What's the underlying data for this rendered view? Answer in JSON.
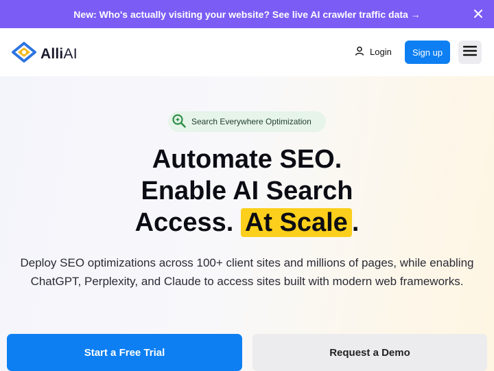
{
  "announcement": {
    "text": "New: Who's actually visiting your website? See live AI crawler traffic data →",
    "close_icon": "close-icon"
  },
  "nav": {
    "brand_bold": "Alli",
    "brand_light": "AI",
    "login_label": "Login",
    "signup_label": "Sign up",
    "menu_icon": "hamburger-menu-icon"
  },
  "hero": {
    "pill_text": "Search Everywhere Optimization",
    "headline_line1": "Automate SEO.",
    "headline_line2": "Enable AI Search",
    "headline_line3_prefix": "Access. ",
    "headline_highlight": "At Scale",
    "headline_line3_suffix": ".",
    "subtitle": "Deploy SEO optimizations across 100+ client sites and millions of pages, while enabling ChatGPT, Perplexity, and Claude to access sites built with modern web frameworks.",
    "primary_cta": "Start a Free Trial",
    "secondary_cta": "Request a Demo"
  },
  "colors": {
    "announcement_bg": "#7b5cf5",
    "primary": "#0d7ff2",
    "highlight": "#fbcf1b",
    "pill_bg": "#e6f4ea"
  }
}
